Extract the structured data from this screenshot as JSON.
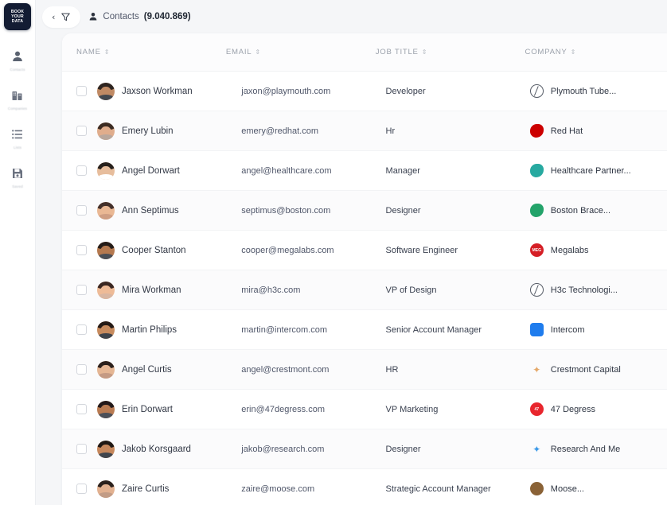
{
  "sidebar": {
    "logo_lines": [
      "BOOK",
      "YOUR",
      "DATA"
    ],
    "items": [
      {
        "icon": "person-icon",
        "label": "Contacts"
      },
      {
        "icon": "buildings-icon",
        "label": "Companies"
      },
      {
        "icon": "list-icon",
        "label": "Lists"
      },
      {
        "icon": "save-icon",
        "label": "Saved"
      }
    ]
  },
  "topbar": {
    "back_chevron": "‹",
    "filter_icon": "funnel-icon",
    "breadcrumb_icon": "person-icon",
    "breadcrumb_label": "Contacts",
    "breadcrumb_count": "(9.040.869)"
  },
  "table": {
    "sort_glyph": "⇕",
    "columns": [
      {
        "key": "name",
        "label": "NAME"
      },
      {
        "key": "email",
        "label": "EMAIL"
      },
      {
        "key": "job",
        "label": "JOB TITLE"
      },
      {
        "key": "company",
        "label": "COMPANY"
      }
    ],
    "rows": [
      {
        "name": "Jaxson Workman",
        "email": "jaxon@playmouth.com",
        "job": "Developer",
        "company": "Plymouth Tube...",
        "logo_style": "ring",
        "logo_color": "#555b66",
        "logo_text": "",
        "avatar": {
          "hair": "#2d2420",
          "skin": "#c08a64",
          "body": "#43484f"
        }
      },
      {
        "name": "Emery Lubin",
        "email": "emery@redhat.com",
        "job": "Hr",
        "company": "Red Hat",
        "logo_style": "blob",
        "logo_color": "#cc0000",
        "logo_text": "",
        "avatar": {
          "hair": "#3b2b22",
          "skin": "#e0ad8c",
          "body": "#b9a79c"
        }
      },
      {
        "name": "Angel Dorwart",
        "email": "angel@healthcare.com",
        "job": "Manager",
        "company": "Healthcare Partner...",
        "logo_style": "blob",
        "logo_color": "#27a9a0",
        "logo_text": "",
        "avatar": {
          "hair": "#26201c",
          "skin": "#e7bd9c",
          "body": "#ffffff"
        }
      },
      {
        "name": "Ann Septimus",
        "email": "septimus@boston.com",
        "job": "Designer",
        "company": "Boston Brace...",
        "logo_style": "blob",
        "logo_color": "#23a36a",
        "logo_text": "",
        "avatar": {
          "hair": "#43302a",
          "skin": "#eab894",
          "body": "#cf9e83"
        }
      },
      {
        "name": "Cooper Stanton",
        "email": "cooper@megalabs.com",
        "job": "Software Engineer",
        "company": "Megalabs",
        "logo_style": "circle",
        "logo_color": "#d51f26",
        "logo_text": "MEG",
        "avatar": {
          "hair": "#241c18",
          "skin": "#b5794f",
          "body": "#4a4f57"
        }
      },
      {
        "name": "Mira Workman",
        "email": "mira@h3c.com",
        "job": "VP of Design",
        "company": "H3c Technologi...",
        "logo_style": "ring",
        "logo_color": "#555b66",
        "logo_text": "",
        "avatar": {
          "hair": "#3a2722",
          "skin": "#eebb97",
          "body": "#d8b6a2"
        }
      },
      {
        "name": "Martin Philips",
        "email": "martin@intercom.com",
        "job": "Senior Account Manager",
        "company": "Intercom",
        "logo_style": "sq",
        "logo_color": "#1f7ced",
        "logo_text": "",
        "avatar": {
          "hair": "#241a16",
          "skin": "#c78b5e",
          "body": "#3e444c"
        }
      },
      {
        "name": "Angel Curtis",
        "email": "angel@crestmont.com",
        "job": "HR",
        "company": "Crestmont Capital",
        "logo_style": "plain",
        "logo_color": "#e5a96a",
        "logo_text": "",
        "avatar": {
          "hair": "#2b201c",
          "skin": "#e5b694",
          "body": "#c49a84"
        }
      },
      {
        "name": "Erin Dorwart",
        "email": "erin@47degress.com",
        "job": "VP Marketing",
        "company": "47 Degress",
        "logo_style": "circle",
        "logo_color": "#e8262d",
        "logo_text": "47",
        "avatar": {
          "hair": "#22191a",
          "skin": "#b97b52",
          "body": "#4b5059"
        }
      },
      {
        "name": "Jakob Korsgaard",
        "email": "jakob@research.com",
        "job": "Designer",
        "company": "Research And Me",
        "logo_style": "plain",
        "logo_color": "#3d9ae8",
        "logo_text": "",
        "avatar": {
          "hair": "#1f1814",
          "skin": "#c5875c",
          "body": "#3f454d"
        }
      },
      {
        "name": "Zaire Curtis",
        "email": "zaire@moose.com",
        "job": "Strategic Account Manager",
        "company": "Moose...",
        "logo_style": "circle",
        "logo_color": "#8a6236",
        "logo_text": "",
        "avatar": {
          "hair": "#2b211d",
          "skin": "#e2b190",
          "body": "#c29c86"
        }
      }
    ]
  },
  "colors": {
    "page_bg": "#f5f6f8",
    "card_bg": "#ffffff",
    "logo_navy": "#131c33",
    "header_text": "#9ba1ab"
  }
}
